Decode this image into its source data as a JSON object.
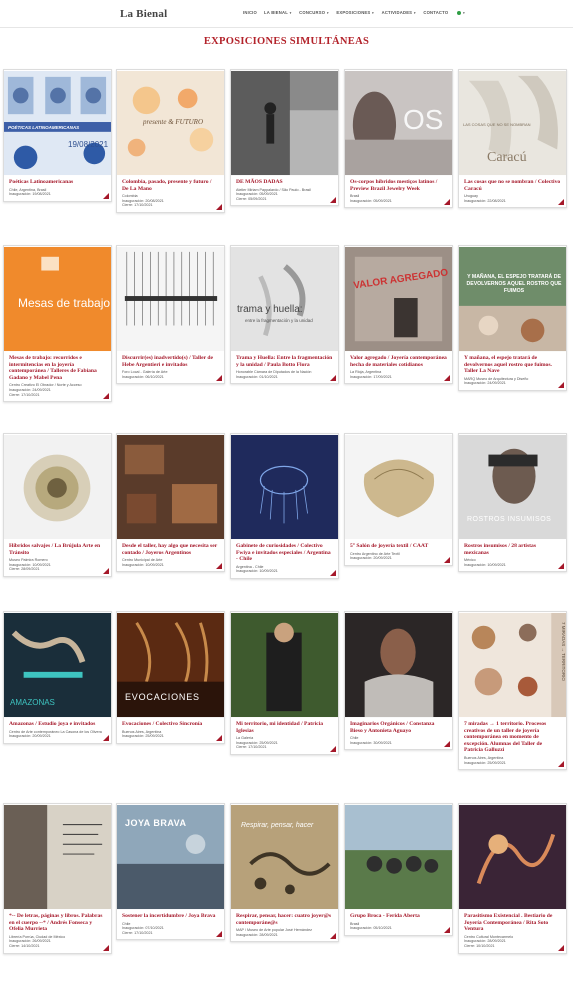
{
  "header": {
    "brand": "La Bienal",
    "nav": [
      {
        "label": "INICIO",
        "caret": false
      },
      {
        "label": "LA BIENAL",
        "caret": true
      },
      {
        "label": "CONCURSO",
        "caret": true
      },
      {
        "label": "EXPOSICIONES",
        "caret": true
      },
      {
        "label": "ACTIVIDADES",
        "caret": true
      },
      {
        "label": "CONTACTO",
        "caret": false
      }
    ]
  },
  "page_title": "EXPOSICIONES SIMULTÁNEAS",
  "colors": {
    "accent": "#a5182a",
    "title": "#b3232b"
  },
  "cards": [
    {
      "title": "Poéticas Latinoamericanas",
      "meta": [
        "Chile, Argentina, Brasil",
        "Inauguración: 19/08/2021"
      ],
      "overlay": "19/08/2021",
      "overlay2": "POÉTICAS LATINOAMERICANAS"
    },
    {
      "title": "Colombia, pasado, presente y futuro / De La Mano",
      "meta": [
        "Colombia",
        "Inauguración: 20/08/2021",
        "Cierre: 17/10/2021"
      ],
      "overlay": "presente & FUTURO"
    },
    {
      "title": "DE MÃOS DADAS",
      "meta": [
        "Atelier Miriam Pappalardo / São Paulo - Brasil",
        "Inauguración: 05/09/2021",
        "Cierre: 05/09/2021"
      ]
    },
    {
      "title": "Os-corpos híbridos mestiços latinos / Preview Brazil Jewelry Week",
      "meta": [
        "Brasil",
        "Inauguración: 05/09/2021"
      ],
      "overlay": "OS"
    },
    {
      "title": "Las cosas que no se nombran / Colectivo Caracú",
      "meta": [
        "Uruguay",
        "Inauguración: 22/08/2021"
      ],
      "overlay": "Caracú",
      "overlay2": "LAS COSAS QUE NO SE NOMBRAN"
    },
    {
      "title": "Mesas de trabajo: recorridos e intermitencias en la joyería contemporánea / Talleres de Fabiana Gadano y Mabel Pena",
      "meta": [
        "Centro Creativo El Obrador / Norte y Acceso",
        "Inauguración: 24/09/2021",
        "Cierre: 17/10/2021"
      ],
      "overlay": "Mesas de trabajo"
    },
    {
      "title": "Discurrir(es) inadvertido(s) / Taller de Hebe Argentieri e invitados",
      "meta": [
        "Foro Local - Galería de Arte",
        "Inauguración: 06/10/2021"
      ]
    },
    {
      "title": "Trama y Huella: Entre la fragmentación y la unidad / Paula Botto Flora",
      "meta": [
        "Honorable Cámara de Diputados de la Nación",
        "Inauguración: 01/10/2021"
      ],
      "overlay": "trama y huella:",
      "overlay2": "entre la fragmentación y la unidad"
    },
    {
      "title": "Valor agregado / Joyería contemporánea hecha de materiales cotidianos",
      "meta": [
        "La Rioja, Argentina",
        "Inauguración: 17/09/2021"
      ],
      "overlay": "VALOR AGREGADO"
    },
    {
      "title": "Y mañana, el espejo tratará de devolvernos aquel rostro que fuimos. Taller La Nave",
      "meta": [
        "MARQ Museo de Arquitectura y Diseño",
        "Inauguración: 24/09/2021"
      ],
      "overlay": "Y MAÑANA, EL ESPEJO TRATARÁ DE DEVOLVERNOS AQUEL ROSTRO QUE FUIMOS"
    },
    {
      "title": "Híbridos salvajes / La Brújula Arte en Tránsito",
      "meta": [
        "Museo Palmira Romero",
        "Inauguración: 10/09/2021",
        "Cierre: 28/09/2021"
      ]
    },
    {
      "title": "Desde el taller, hay algo que necesita ser contado / Joyeros Argentinos",
      "meta": [
        "Centro Municipal de Arte",
        "Inauguración: 10/09/2021"
      ]
    },
    {
      "title": "Gabinete de curiosidades / Colectivo Fwiya e invitados especiales / Argentina - Chile",
      "meta": [
        "Argentina - Chile",
        "Inauguración: 10/09/2021"
      ]
    },
    {
      "title": "5° Salón de joyería textil / CAAT",
      "meta": [
        "Centro Argentino de Arte Textil",
        "Inauguración: 20/09/2021"
      ]
    },
    {
      "title": "Rostros insumisos / 28 artistas mexicanas",
      "meta": [
        "México",
        "Inauguración: 10/09/2021"
      ],
      "overlay": "ROSTROS INSUMISOS"
    },
    {
      "title": "Amazonas / Estudio joya e invitados",
      "meta": [
        "Centro de Arte contemporáneo La Casona de los Olivera",
        "Inauguración: 20/09/2021"
      ],
      "overlay": "AMAZONAS"
    },
    {
      "title": "Evocaciones / Colectivo Sincronía",
      "meta": [
        "Buenos Aires, Argentina",
        "Inauguración: 25/09/2021"
      ],
      "overlay": "EVOCACIONES"
    },
    {
      "title": "Mi territorio, mi identidad / Patricia Iglesias",
      "meta": [
        "La Galería",
        "Inauguración: 25/09/2021",
        "Cierre: 17/10/2021"
      ]
    },
    {
      "title": "Imaginarios Orgánicos / Constanza Bieso y Antonieta Aguayo",
      "meta": [
        "Chile",
        "Inauguración: 30/09/2021"
      ]
    },
    {
      "title": "7 miradas → 1 territorio. Procesos creativos de un taller de joyería contemporánea en momento de excepción. Alumnas del Taller de Patricia Galluzzi",
      "meta": [
        "Buenos Aires, Argentina",
        "Inauguración: 25/09/2021"
      ],
      "overlay": "7 MIRADAS → TERRITORIO"
    },
    {
      "title": "*-- De letras, páginas y libros. Palabras en el cuerpo --* / Andrés Fonseca y Ofelia Murrieta",
      "meta": [
        "Librería Porrúa, Ciudad de México",
        "Inauguración: 26/09/2021",
        "Cierre: 14/10/2021"
      ]
    },
    {
      "title": "Sostener la incertidumbre / Joya Brava",
      "meta": [
        "Chile",
        "Inauguración: 07/10/2021",
        "Cierre: 17/10/2021"
      ],
      "overlay": "JOYA BRAVA"
    },
    {
      "title": "Respirar, pensar, hacer: cuatro joyer@s contemporáne@s",
      "meta": [
        "MAP / Museo de Arte popular José Hernández",
        "Inauguración: 28/09/2021"
      ],
      "overlay": "Respirar, pensar, hacer"
    },
    {
      "title": "Grupo Broca - Ferida Aberta",
      "meta": [
        "Brasil",
        "Inauguración: 05/10/2021"
      ]
    },
    {
      "title": "Parasitismo Existencial . Bestiario de Joyería Contemporánea / Rita Soto Ventura",
      "meta": [
        "Centro Cultural Montecarmelo",
        "Inauguración: 28/09/2021",
        "Cierre: 10/10/2021"
      ]
    }
  ]
}
